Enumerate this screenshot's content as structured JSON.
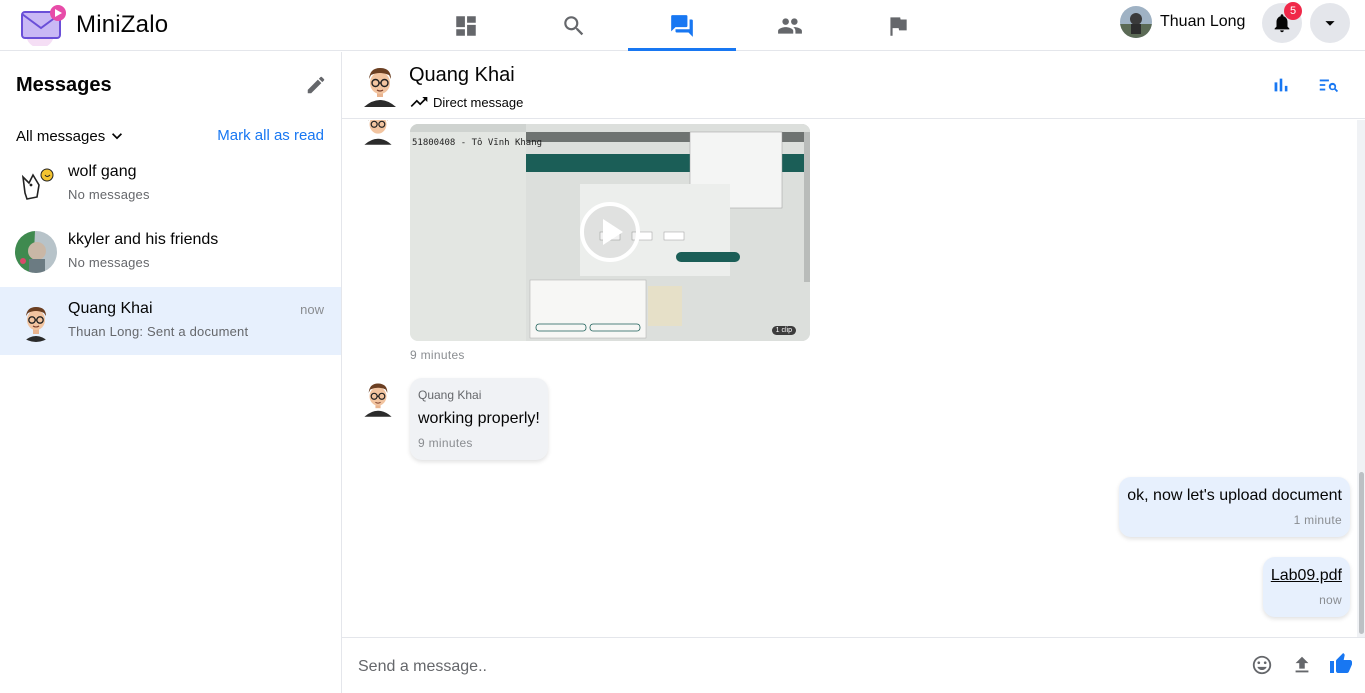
{
  "app": {
    "name": "MiniZalo"
  },
  "nav": [
    {
      "id": "dashboard",
      "icon": "dashboard-icon"
    },
    {
      "id": "search",
      "icon": "search-icon"
    },
    {
      "id": "messages",
      "icon": "forum-icon",
      "active": true
    },
    {
      "id": "people",
      "icon": "people-icon"
    },
    {
      "id": "reports",
      "icon": "flag-icon"
    }
  ],
  "account": {
    "name": "Thuan Long",
    "notifications": "5"
  },
  "sidebar": {
    "title": "Messages",
    "filter": "All messages",
    "mark_all": "Mark all as read",
    "conversations": [
      {
        "name": "wolf gang",
        "subtitle": "No messages",
        "time": ""
      },
      {
        "name": "kkyler and his friends",
        "subtitle": "No messages",
        "time": ""
      },
      {
        "name": "Quang Khai",
        "subtitle": "Thuan Long: Sent a document",
        "time": "now",
        "active": true
      }
    ]
  },
  "chat": {
    "name": "Quang Khai",
    "subtitle": "Direct message",
    "messages": [
      {
        "type": "video",
        "sender": "Quang Khai",
        "overlay_text": "51800408 - Tô Vĩnh Khang",
        "duration": "1 clip",
        "time": "9 minutes"
      },
      {
        "type": "text",
        "direction": "in",
        "sender": "Quang Khai",
        "text": "working properly!",
        "time": "9 minutes"
      },
      {
        "type": "text",
        "direction": "out",
        "text": "ok, now let's upload document",
        "time": "1 minute"
      },
      {
        "type": "file",
        "direction": "out",
        "filename": "Lab09.pdf",
        "time": "now"
      }
    ],
    "composer": {
      "placeholder": "Send a message.."
    }
  },
  "colors": {
    "accent": "#1877f2",
    "badge": "#f02849",
    "active_conv": "#e7f0fd"
  }
}
